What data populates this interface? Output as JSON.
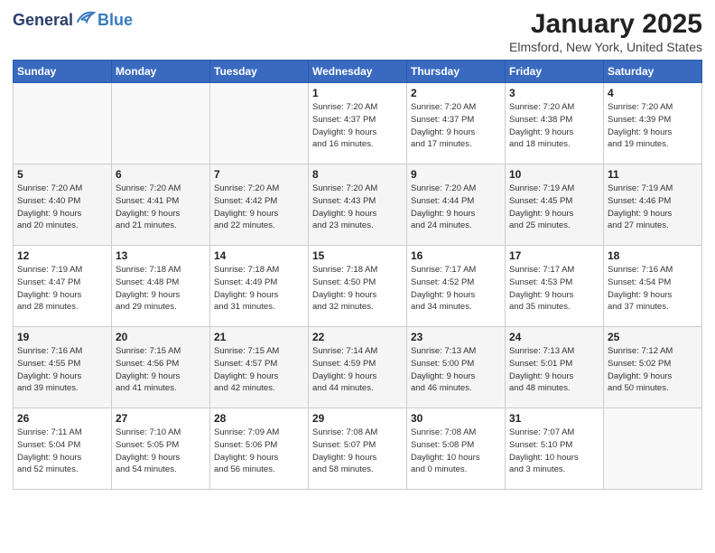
{
  "header": {
    "logo_general": "General",
    "logo_blue": "Blue",
    "month": "January 2025",
    "location": "Elmsford, New York, United States"
  },
  "days_of_week": [
    "Sunday",
    "Monday",
    "Tuesday",
    "Wednesday",
    "Thursday",
    "Friday",
    "Saturday"
  ],
  "weeks": [
    [
      {
        "day": "",
        "info": ""
      },
      {
        "day": "",
        "info": ""
      },
      {
        "day": "",
        "info": ""
      },
      {
        "day": "1",
        "info": "Sunrise: 7:20 AM\nSunset: 4:37 PM\nDaylight: 9 hours\nand 16 minutes."
      },
      {
        "day": "2",
        "info": "Sunrise: 7:20 AM\nSunset: 4:37 PM\nDaylight: 9 hours\nand 17 minutes."
      },
      {
        "day": "3",
        "info": "Sunrise: 7:20 AM\nSunset: 4:38 PM\nDaylight: 9 hours\nand 18 minutes."
      },
      {
        "day": "4",
        "info": "Sunrise: 7:20 AM\nSunset: 4:39 PM\nDaylight: 9 hours\nand 19 minutes."
      }
    ],
    [
      {
        "day": "5",
        "info": "Sunrise: 7:20 AM\nSunset: 4:40 PM\nDaylight: 9 hours\nand 20 minutes."
      },
      {
        "day": "6",
        "info": "Sunrise: 7:20 AM\nSunset: 4:41 PM\nDaylight: 9 hours\nand 21 minutes."
      },
      {
        "day": "7",
        "info": "Sunrise: 7:20 AM\nSunset: 4:42 PM\nDaylight: 9 hours\nand 22 minutes."
      },
      {
        "day": "8",
        "info": "Sunrise: 7:20 AM\nSunset: 4:43 PM\nDaylight: 9 hours\nand 23 minutes."
      },
      {
        "day": "9",
        "info": "Sunrise: 7:20 AM\nSunset: 4:44 PM\nDaylight: 9 hours\nand 24 minutes."
      },
      {
        "day": "10",
        "info": "Sunrise: 7:19 AM\nSunset: 4:45 PM\nDaylight: 9 hours\nand 25 minutes."
      },
      {
        "day": "11",
        "info": "Sunrise: 7:19 AM\nSunset: 4:46 PM\nDaylight: 9 hours\nand 27 minutes."
      }
    ],
    [
      {
        "day": "12",
        "info": "Sunrise: 7:19 AM\nSunset: 4:47 PM\nDaylight: 9 hours\nand 28 minutes."
      },
      {
        "day": "13",
        "info": "Sunrise: 7:18 AM\nSunset: 4:48 PM\nDaylight: 9 hours\nand 29 minutes."
      },
      {
        "day": "14",
        "info": "Sunrise: 7:18 AM\nSunset: 4:49 PM\nDaylight: 9 hours\nand 31 minutes."
      },
      {
        "day": "15",
        "info": "Sunrise: 7:18 AM\nSunset: 4:50 PM\nDaylight: 9 hours\nand 32 minutes."
      },
      {
        "day": "16",
        "info": "Sunrise: 7:17 AM\nSunset: 4:52 PM\nDaylight: 9 hours\nand 34 minutes."
      },
      {
        "day": "17",
        "info": "Sunrise: 7:17 AM\nSunset: 4:53 PM\nDaylight: 9 hours\nand 35 minutes."
      },
      {
        "day": "18",
        "info": "Sunrise: 7:16 AM\nSunset: 4:54 PM\nDaylight: 9 hours\nand 37 minutes."
      }
    ],
    [
      {
        "day": "19",
        "info": "Sunrise: 7:16 AM\nSunset: 4:55 PM\nDaylight: 9 hours\nand 39 minutes."
      },
      {
        "day": "20",
        "info": "Sunrise: 7:15 AM\nSunset: 4:56 PM\nDaylight: 9 hours\nand 41 minutes."
      },
      {
        "day": "21",
        "info": "Sunrise: 7:15 AM\nSunset: 4:57 PM\nDaylight: 9 hours\nand 42 minutes."
      },
      {
        "day": "22",
        "info": "Sunrise: 7:14 AM\nSunset: 4:59 PM\nDaylight: 9 hours\nand 44 minutes."
      },
      {
        "day": "23",
        "info": "Sunrise: 7:13 AM\nSunset: 5:00 PM\nDaylight: 9 hours\nand 46 minutes."
      },
      {
        "day": "24",
        "info": "Sunrise: 7:13 AM\nSunset: 5:01 PM\nDaylight: 9 hours\nand 48 minutes."
      },
      {
        "day": "25",
        "info": "Sunrise: 7:12 AM\nSunset: 5:02 PM\nDaylight: 9 hours\nand 50 minutes."
      }
    ],
    [
      {
        "day": "26",
        "info": "Sunrise: 7:11 AM\nSunset: 5:04 PM\nDaylight: 9 hours\nand 52 minutes."
      },
      {
        "day": "27",
        "info": "Sunrise: 7:10 AM\nSunset: 5:05 PM\nDaylight: 9 hours\nand 54 minutes."
      },
      {
        "day": "28",
        "info": "Sunrise: 7:09 AM\nSunset: 5:06 PM\nDaylight: 9 hours\nand 56 minutes."
      },
      {
        "day": "29",
        "info": "Sunrise: 7:08 AM\nSunset: 5:07 PM\nDaylight: 9 hours\nand 58 minutes."
      },
      {
        "day": "30",
        "info": "Sunrise: 7:08 AM\nSunset: 5:08 PM\nDaylight: 10 hours\nand 0 minutes."
      },
      {
        "day": "31",
        "info": "Sunrise: 7:07 AM\nSunset: 5:10 PM\nDaylight: 10 hours\nand 3 minutes."
      },
      {
        "day": "",
        "info": ""
      }
    ]
  ]
}
